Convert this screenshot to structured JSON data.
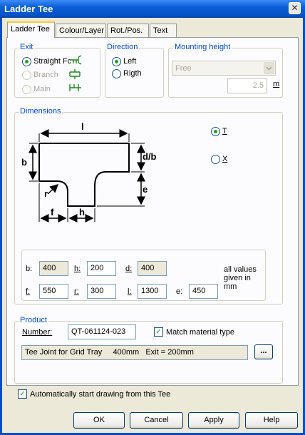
{
  "window": {
    "title": "Ladder Tee",
    "close_glyph": "✕"
  },
  "tabs": [
    "Ladder Tee",
    "Colour/Layer",
    "Rot./Pos.",
    "Text"
  ],
  "exit": {
    "label": "Exit",
    "options": [
      {
        "label": "Straight Fc",
        "checked": true,
        "enabled": true
      },
      {
        "label": "Branch",
        "checked": false,
        "enabled": false
      },
      {
        "label": "Main",
        "checked": false,
        "enabled": false
      }
    ]
  },
  "direction": {
    "label": "Direction",
    "options": [
      {
        "label": "Left",
        "checked": true
      },
      {
        "label": "Rigth",
        "checked": false
      }
    ]
  },
  "mounting": {
    "label": "Mounting height",
    "select_value": "Free",
    "value": "2.5",
    "unit": "m"
  },
  "dimensions": {
    "label": "Dimensions",
    "shape_T": "T",
    "shape_X": "X",
    "drawing_labels": {
      "l": "l",
      "b": "b",
      "db": "d/b",
      "e": "e",
      "r": "r",
      "f": "f",
      "h": "h"
    },
    "fields": {
      "b": {
        "label": "b:",
        "value": "400"
      },
      "h": {
        "label": "h:",
        "value": "200"
      },
      "d": {
        "label": "d:",
        "value": "400"
      },
      "f": {
        "label": "f:",
        "value": "550"
      },
      "r": {
        "label": "r:",
        "value": "300"
      },
      "l": {
        "label": "l:",
        "value": "1300"
      },
      "e": {
        "label": "e:",
        "value": "450"
      }
    },
    "note": "all values given in mm"
  },
  "product": {
    "label": "Product",
    "number_label": "Number:",
    "number": "QT-061124-023",
    "match_material": "Match material type",
    "description": "Tee Joint for Grid Tray     400mm   Exit = 200mm",
    "browse": "..."
  },
  "auto_start": "Automatically start drawing from this Tee",
  "buttons": {
    "ok": "OK",
    "cancel": "Cancel",
    "apply": "Apply",
    "help": "Help"
  },
  "colors": {
    "title_bar": "#0a5fd8",
    "group_label": "#0046d5",
    "dialog_bg": "#ece9d8",
    "tab_active_accent": "#ffc83c",
    "check_green": "#21a121"
  }
}
